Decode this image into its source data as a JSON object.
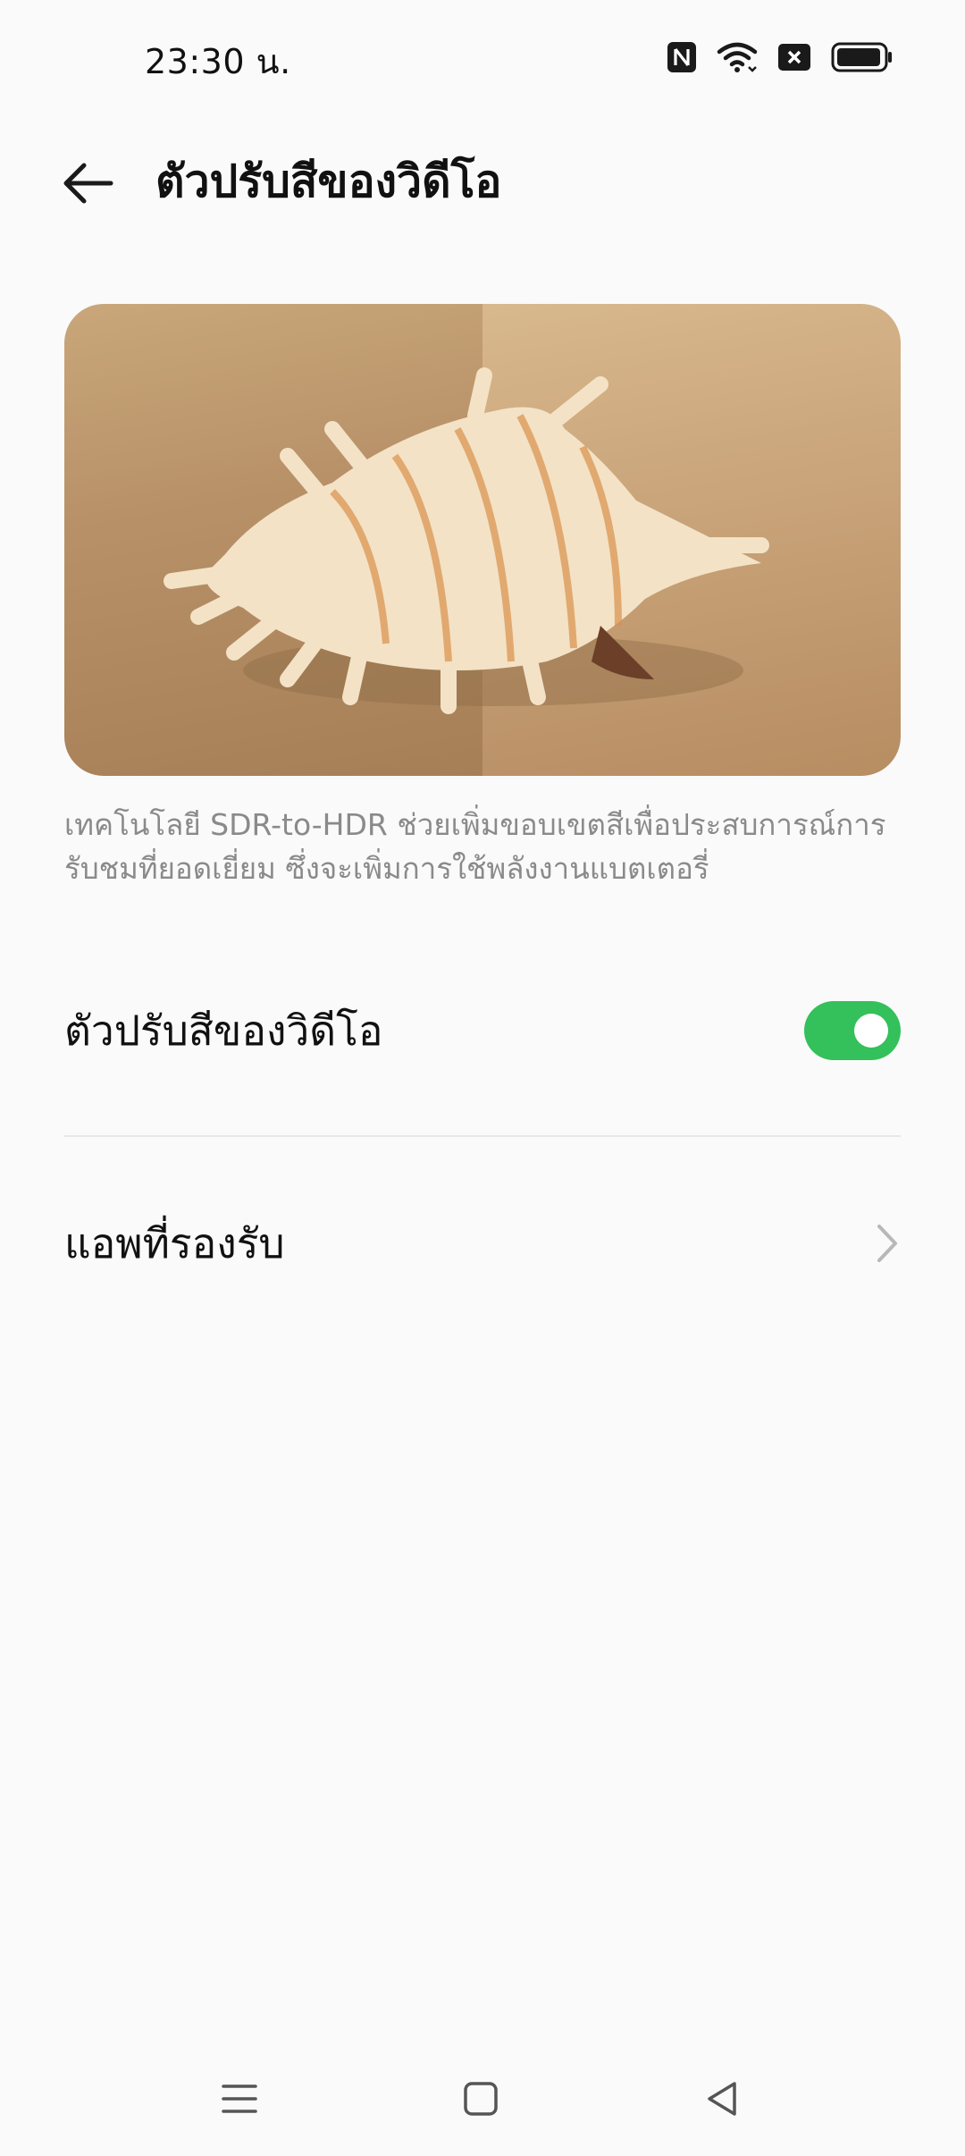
{
  "status_bar": {
    "time": "23:30 น.",
    "icons": [
      "nfc-icon",
      "wifi-icon",
      "no-sim-icon",
      "battery-icon"
    ]
  },
  "app_bar": {
    "title": "ตัวปรับสีของวิดีโอ",
    "back_icon": "arrow-left-icon"
  },
  "preview": {
    "description": "เทคโนโลยี SDR-to-HDR ช่วยเพิ่มขอบเขตสีเพื่อประสบการณ์การรับชมที่ยอดเยี่ยม ซึ่งจะเพิ่มการใช้พลังงานแบตเตอรี่"
  },
  "settings": {
    "video_color": {
      "label": "ตัวปรับสีของวิดีโอ",
      "enabled": true
    },
    "supported_apps": {
      "label": "แอพที่รองรับ",
      "icon": "chevron-right-icon"
    }
  },
  "nav_bar": {
    "items": [
      "menu-icon",
      "home-icon",
      "back-icon"
    ]
  },
  "colors": {
    "toggle_on": "#34c05a",
    "background": "#fafafa",
    "secondary_text": "#8a8a8a"
  }
}
